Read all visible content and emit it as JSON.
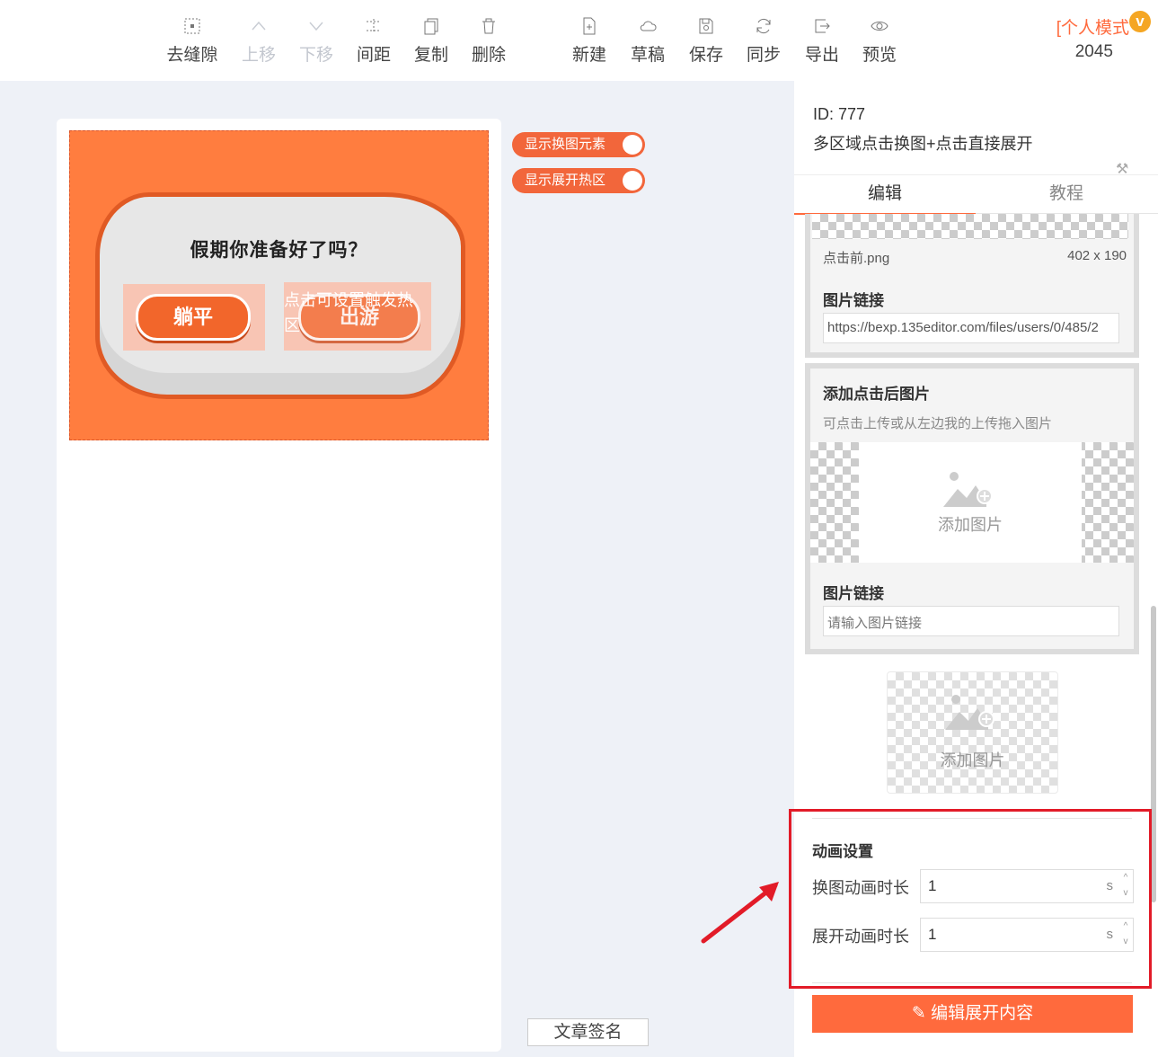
{
  "toolbar": {
    "items": [
      {
        "label": "去缝隙",
        "icon": "no-gap-icon",
        "disabled": false
      },
      {
        "label": "上移",
        "icon": "chevron-up-icon",
        "disabled": true
      },
      {
        "label": "下移",
        "icon": "chevron-down-icon",
        "disabled": true
      },
      {
        "label": "间距",
        "icon": "spacing-icon",
        "disabled": false
      },
      {
        "label": "复制",
        "icon": "copy-icon",
        "disabled": false
      },
      {
        "label": "删除",
        "icon": "trash-icon",
        "disabled": false
      },
      {
        "label": "新建",
        "icon": "new-file-icon",
        "disabled": false
      },
      {
        "label": "草稿",
        "icon": "cloud-icon",
        "disabled": false
      },
      {
        "label": "保存",
        "icon": "save-icon",
        "disabled": false
      },
      {
        "label": "同步",
        "icon": "sync-icon",
        "disabled": false
      },
      {
        "label": "导出",
        "icon": "export-icon",
        "disabled": false
      },
      {
        "label": "预览",
        "icon": "eye-icon",
        "disabled": false
      }
    ],
    "mode": "[个人模式",
    "badge": "v",
    "user_number": "2045"
  },
  "canvas": {
    "title": "假期你准备好了吗？",
    "button_left": "躺平",
    "button_right": "出游",
    "hotzone_hint": "点击可设置触发热区",
    "toggle_show_swap": "显示换图元素",
    "toggle_show_expand": "显示展开热区",
    "sign_button": "文章签名"
  },
  "panel": {
    "id_line": "ID: 777",
    "name": "多区域点击换图+点击直接展开",
    "tabs": [
      "编辑",
      "教程"
    ],
    "before_card": {
      "file_name": "点击前.png",
      "dimensions": "402 x 190",
      "link_label": "图片链接",
      "link_value": "https://bexp.135editor.com/files/users/0/485/2"
    },
    "after_card": {
      "title": "添加点击后图片",
      "hint": "可点击上传或从左边我的上传拖入图片",
      "add_label": "添加图片",
      "link_label": "图片链接",
      "link_placeholder": "请输入图片链接"
    },
    "add_image_label": "添加图片",
    "animation": {
      "title": "动画设置",
      "swap_label": "换图动画时长",
      "swap_value": "1",
      "expand_label": "展开动画时长",
      "expand_value": "1",
      "unit": "s"
    },
    "edit_button": "编辑展开内容"
  },
  "colors": {
    "accent": "#ff6a3d",
    "highlight_box": "#e21b28"
  }
}
